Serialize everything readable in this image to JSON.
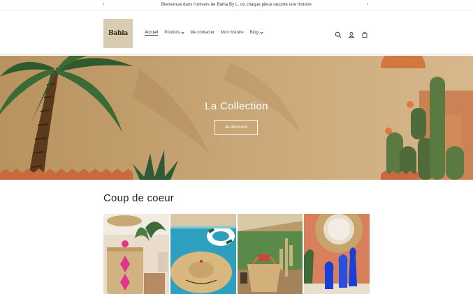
{
  "announcement": {
    "message": "Bienvenue dans l'univers de Bahia By L, où chaque pièce raconte une histoire",
    "prev_icon": "chevron-left-icon",
    "next_icon": "chevron-right-icon"
  },
  "header": {
    "logo_text": "Bahia",
    "nav": [
      {
        "label": "Accueil",
        "active": true
      },
      {
        "label": "Produits",
        "dropdown": true
      },
      {
        "label": "Me contacter"
      },
      {
        "label": "Mon histoire"
      },
      {
        "label": "Blog",
        "dropdown": true
      }
    ],
    "icons": [
      "search-icon",
      "account-icon",
      "cart-icon"
    ]
  },
  "hero": {
    "title": "La Collection",
    "button_label": "Je découvre"
  },
  "featured": {
    "title": "Coup de coeur",
    "tiles": [
      {
        "subject": "woven basket with pink pattern"
      },
      {
        "subject": "straw hat by pool"
      },
      {
        "subject": "woven bag on table"
      },
      {
        "subject": "blue vases with mirror"
      }
    ]
  },
  "colors": {
    "hero_bg": "#c29b6e",
    "logo_bg": "#d8cdb2",
    "text": "#222222"
  }
}
